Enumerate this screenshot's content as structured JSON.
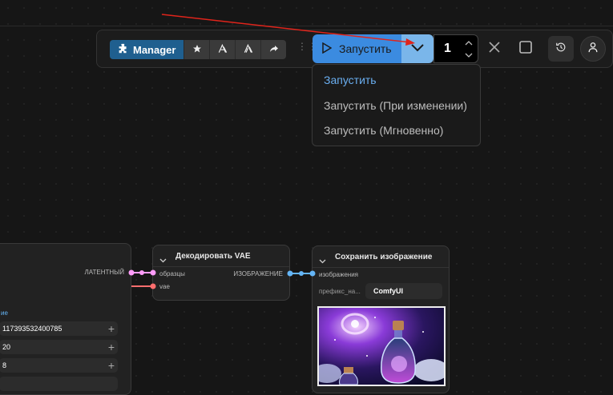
{
  "toolbar": {
    "manager_label": "Manager",
    "run_label": "Запустить",
    "batch_count": "1",
    "icons": [
      "puzzle-icon",
      "star-icon",
      "mask-icon",
      "mask-icon-2",
      "share-icon",
      "grip-icon",
      "play-icon",
      "chevron-down-icon",
      "chevron-up-icon",
      "chevron-down-small-icon",
      "close-icon",
      "stop-icon",
      "history-icon",
      "user-icon"
    ],
    "colors": {
      "manager": "#1f5f8f",
      "run": "#3b8be0",
      "run_toggle": "#7ab6ea",
      "dropdown_active": "#6aaef0",
      "arrow": "#e0241b"
    }
  },
  "run_menu": {
    "items": [
      {
        "label": "Запустить",
        "active": true
      },
      {
        "label": "Запустить (При изменении)",
        "active": false
      },
      {
        "label": "Запустить (Мгновенно)",
        "active": false
      }
    ]
  },
  "nodes": {
    "sampler": {
      "output_label": "ЛАТЕНТНЫЙ",
      "partial_label": "ие",
      "fields": [
        {
          "value": "117393532400785"
        },
        {
          "value": "20"
        },
        {
          "value": "8"
        }
      ]
    },
    "vae_decode": {
      "title": "Декодировать VAE",
      "inputs": [
        "образцы",
        "vae"
      ],
      "output_label": "ИЗОБРАЖЕНИЕ"
    },
    "save_image": {
      "title": "Сохранить изображение",
      "input_label": "изображения",
      "prefix_label": "префикс_на...",
      "prefix_value": "ComfyUI"
    }
  },
  "port_colors": {
    "latent": "#ff9cf9",
    "vae": "#ff6e6e",
    "image": "#64b5f6"
  }
}
